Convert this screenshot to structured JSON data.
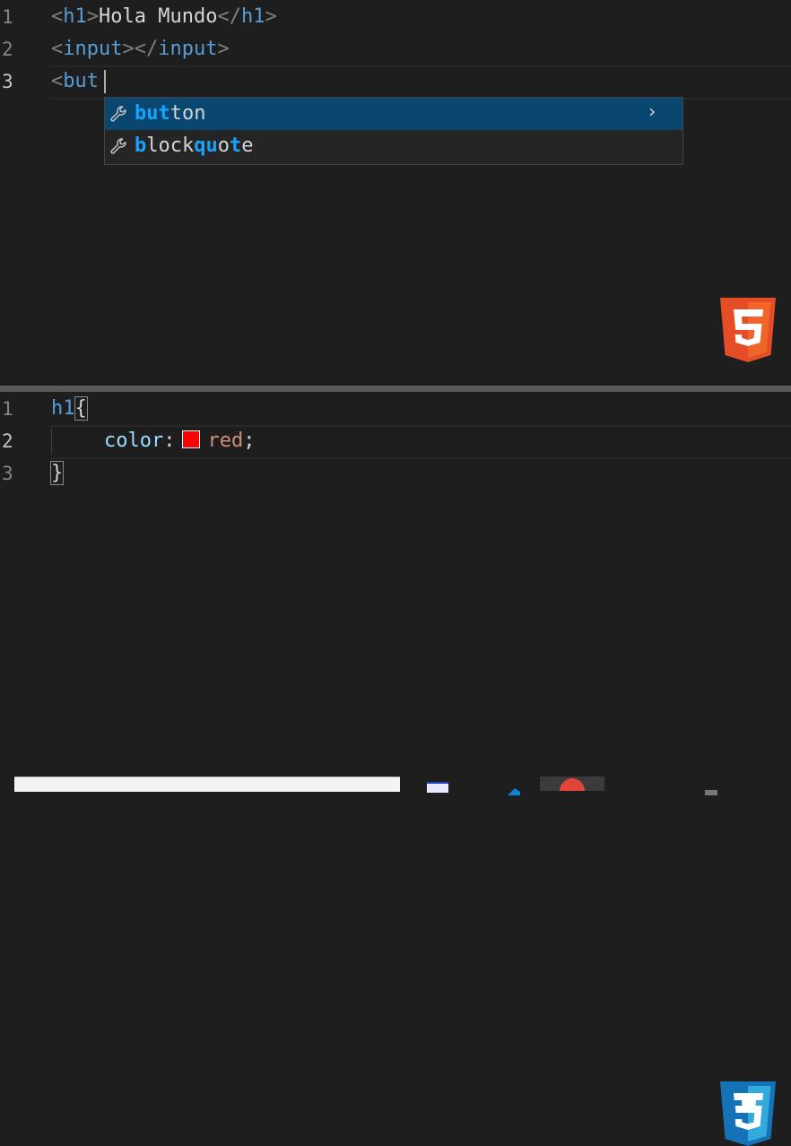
{
  "html_editor": {
    "lines": [
      {
        "number": "1",
        "open": "<",
        "tag": "h1",
        "close": ">",
        "text": "Hola Mundo",
        "end_open": "</",
        "end_tag": "h1",
        "end_close": ">"
      },
      {
        "number": "2",
        "open": "<",
        "tag": "input",
        "close": "></",
        "end_tag": "input",
        "end_close": ">"
      },
      {
        "number": "3",
        "open": "<",
        "tag": "but"
      }
    ],
    "suggestions": [
      {
        "match": "but",
        "rest": "ton",
        "more": "›"
      },
      {
        "parts": [
          "b",
          "lock",
          "q",
          "u",
          "o",
          "t",
          "e"
        ]
      }
    ]
  },
  "css_editor": {
    "lines": [
      {
        "number": "1",
        "selector": "h1",
        "brace": "{"
      },
      {
        "number": "2",
        "property": "color",
        "colon": ":",
        "value": "red",
        "semicolon": ";"
      },
      {
        "number": "3",
        "brace": "}"
      }
    ]
  },
  "colors": {
    "background": "#1e1e1e",
    "tag": "#569cd6",
    "suggest_selected": "#094771",
    "match_highlight": "#18a3ff",
    "swatch": "#ff0000",
    "html5_orange": "#e44d26",
    "css3_blue": "#1572b6"
  },
  "icons": {
    "suggestion": "wrench-icon",
    "html_badge": "html5-logo",
    "css_badge": "css3-logo"
  }
}
